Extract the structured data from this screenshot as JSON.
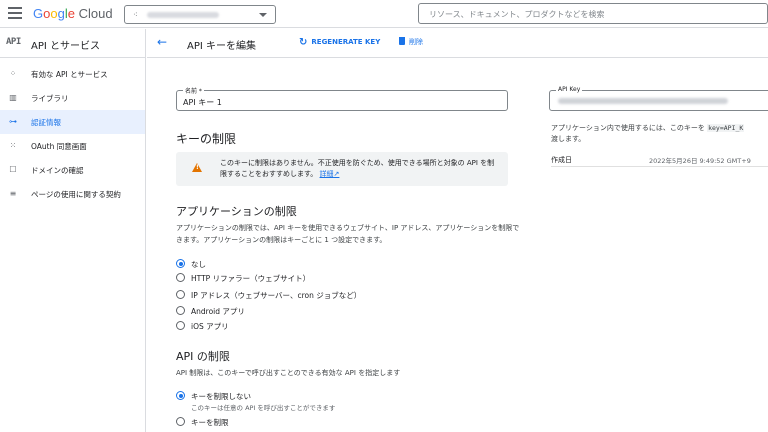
{
  "header": {
    "logo_google": [
      "G",
      "o",
      "o",
      "g",
      "l",
      "e"
    ],
    "logo_cloud": "Cloud",
    "search_placeholder": "リソース、ドキュメント、プロダクトなどを検索"
  },
  "sidebar": {
    "badge": "API",
    "title": "API とサービス",
    "items": [
      {
        "label": "有効な API とサービス",
        "icon": "diamond-grid-icon",
        "glyph": "⁘",
        "active": false
      },
      {
        "label": "ライブラリ",
        "icon": "library-icon",
        "glyph": "▥",
        "active": false
      },
      {
        "label": "認証情報",
        "icon": "key-icon",
        "glyph": "⊶",
        "active": true
      },
      {
        "label": "OAuth 同意画面",
        "icon": "consent-icon",
        "glyph": "⁙",
        "active": false
      },
      {
        "label": "ドメインの確認",
        "icon": "checkbox-icon",
        "glyph": "☐",
        "active": false
      },
      {
        "label": "ページの使用に関する契約",
        "icon": "settings-list-icon",
        "glyph": "≡",
        "active": false
      }
    ]
  },
  "toolbar": {
    "back_glyph": "←",
    "page_title": "API キーを編集",
    "regenerate_label": "REGENERATE KEY",
    "regenerate_glyph": "↻",
    "delete_label": "削除"
  },
  "form": {
    "name_label": "名前 *",
    "name_value": "API キー 1",
    "key_restriction_heading": "キーの制限",
    "warning_text": "このキーに制限はありません。不正使用を防ぐため、使用できる場所と対象の API を制限することをおすすめします。",
    "warning_link": "詳細",
    "warning_link_glyph": "↗",
    "app_restriction_heading": "アプリケーションの制限",
    "app_restriction_desc": "アプリケーションの制限では、API キーを使用できるウェブサイト、IP アドレス、アプリケーションを制限できます。アプリケーションの制限はキーごとに 1 つ設定できます。",
    "app_options": [
      {
        "label": "なし",
        "selected": true
      },
      {
        "label": "HTTP リファラー（ウェブサイト）",
        "selected": false
      },
      {
        "label": "IP アドレス（ウェブサーバー、cron ジョブなど）",
        "selected": false
      },
      {
        "label": "Android アプリ",
        "selected": false
      },
      {
        "label": "iOS アプリ",
        "selected": false
      }
    ],
    "api_restriction_heading": "API の制限",
    "api_restriction_desc": "API 制限は、このキーで呼び出すことのできる有効な API を指定します",
    "api_options": [
      {
        "label": "キーを制限しない",
        "sub": "このキーは任意の API を呼び出すことができます",
        "selected": true
      },
      {
        "label": "キーを制限",
        "sub": "",
        "selected": false
      }
    ]
  },
  "key_panel": {
    "api_key_label": "API Key",
    "usage_text_before": "アプリケーション内で使用するには、このキーを ",
    "usage_code": "key=API_K",
    "usage_text_after": "渡します。",
    "created_label": "作成日",
    "created_value": "2022年5月26日 9:49:52 GMT+9"
  },
  "colors": {
    "accent": "#1a73e8",
    "warning": "#e37400",
    "active_bg": "#e8f0fe"
  }
}
